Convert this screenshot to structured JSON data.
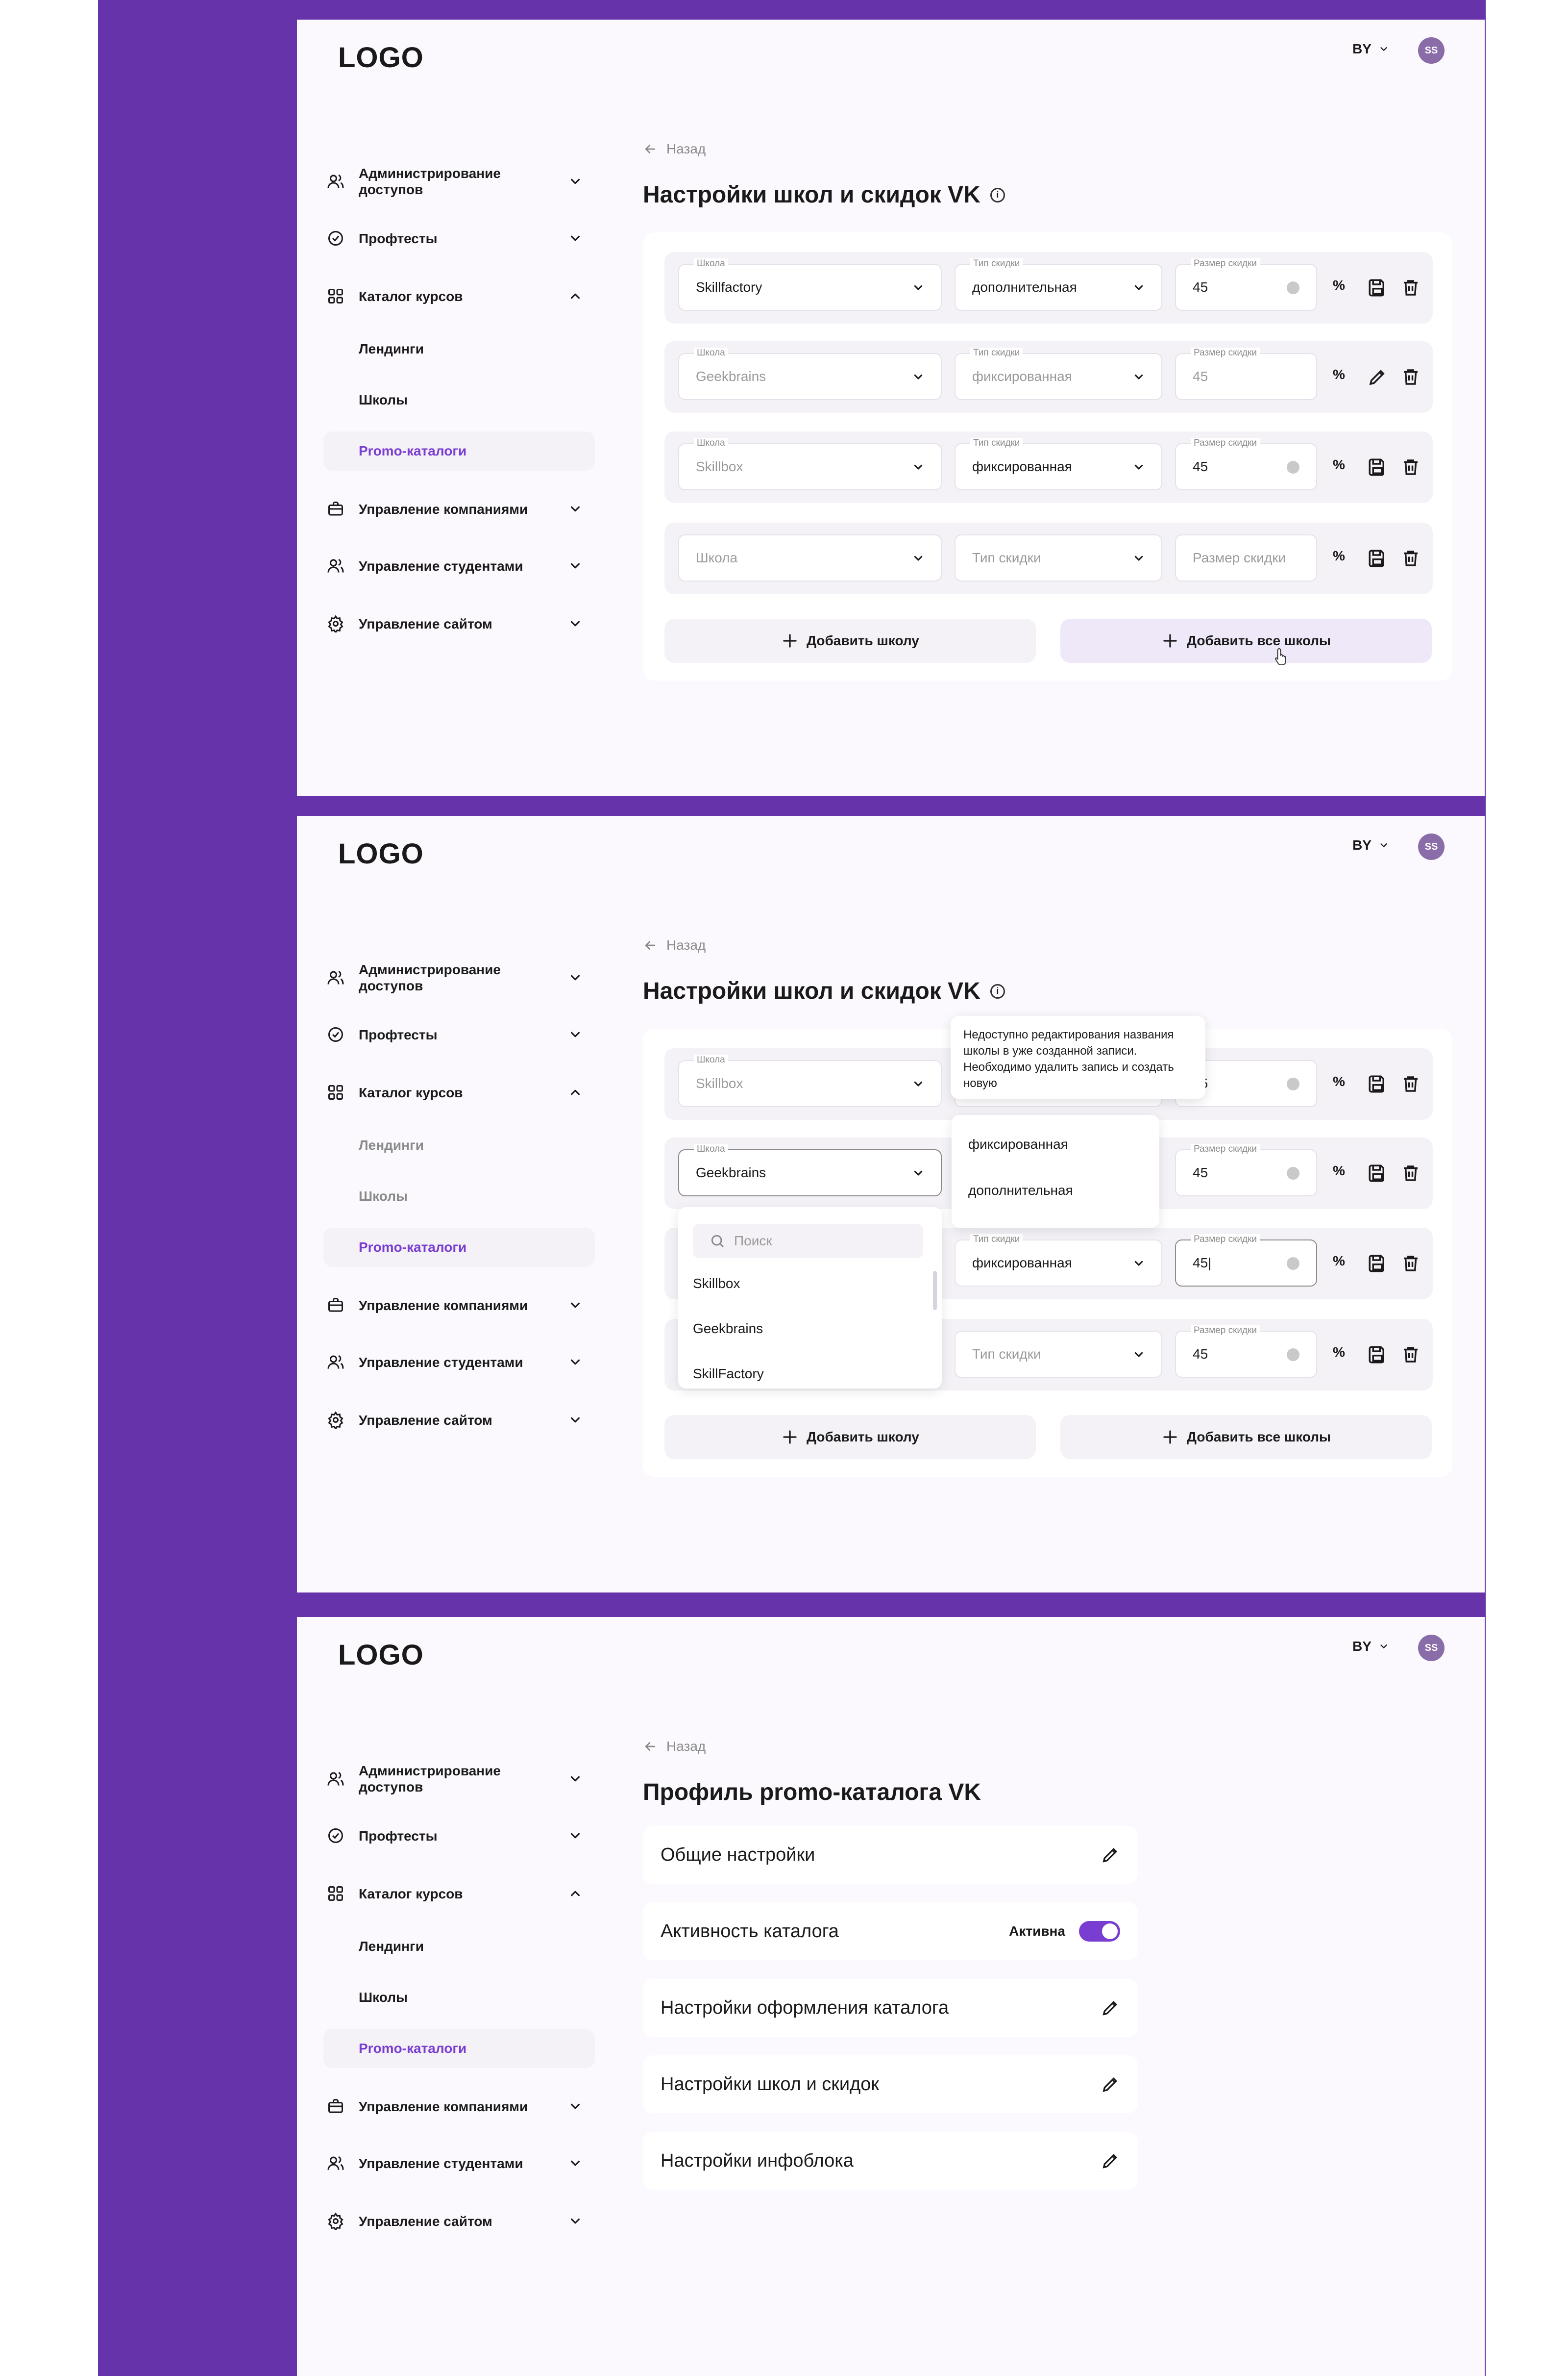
{
  "common": {
    "logo": "LOGO",
    "lang": "BY",
    "avatar": "SS",
    "back": "Назад",
    "nav": {
      "access": "Администрирование доступов",
      "proftests": "Профтесты",
      "catalog": "Каталог курсов",
      "landings": "Лендинги",
      "schools": "Школы",
      "promo": "Promo-каталоги",
      "companies": "Управление компаниями",
      "students": "Управление студентами",
      "site": "Управление сайтом"
    }
  },
  "labels": {
    "school": "Школа",
    "type": "Тип скидки",
    "size": "Размер скидки",
    "percent": "%"
  },
  "screen1": {
    "title": "Настройки школ и скидок VK",
    "rows": [
      {
        "school": "Skillfactory",
        "type": "дополнительная",
        "size": "45",
        "action": "save"
      },
      {
        "school": "Geekbrains",
        "type": "фиксированная",
        "size": "45",
        "action": "edit"
      },
      {
        "school": "Skillbox",
        "type": "фиксированная",
        "size": "45",
        "action": "save"
      },
      {
        "school": "Школа",
        "type": "Тип скидки",
        "size": "Размер скидки",
        "action": "save"
      }
    ],
    "add_school": "Добавить школу",
    "add_all": "Добавить все школы"
  },
  "screen2": {
    "title": "Настройки школ и скидок VK",
    "rows": [
      {
        "school": "Skillbox",
        "size": "45"
      },
      {
        "school": "Geekbrains",
        "size": "45"
      },
      {
        "type": "фиксированная",
        "size": "45|"
      },
      {
        "type": "Тип скидки",
        "size": "45"
      }
    ],
    "tooltip": "Недоступно редактирования названия школы в уже созданной записи. Необходимо удалить запись и создать новую",
    "type_options": [
      "фиксированная",
      "дополнительная"
    ],
    "search_placeholder": "Поиск",
    "school_options": [
      "Skillbox",
      "Geekbrains",
      "SkillFactory"
    ],
    "add_school": "Добавить школу",
    "add_all": "Добавить все школы"
  },
  "screen3": {
    "title": "Профиль promo-каталога VK",
    "items": {
      "general": "Общие настройки",
      "activity": "Активность каталога",
      "activity_status": "Активна",
      "design": "Настройки оформления каталога",
      "schools": "Настройки школ и скидок",
      "infoblock": "Настройки инфоблока"
    },
    "toggle_on": true
  },
  "colors": {
    "frame": "#6633aa",
    "accent": "#7a3dd1",
    "panel": "#fbf9fd",
    "row": "#f4f2f6"
  }
}
